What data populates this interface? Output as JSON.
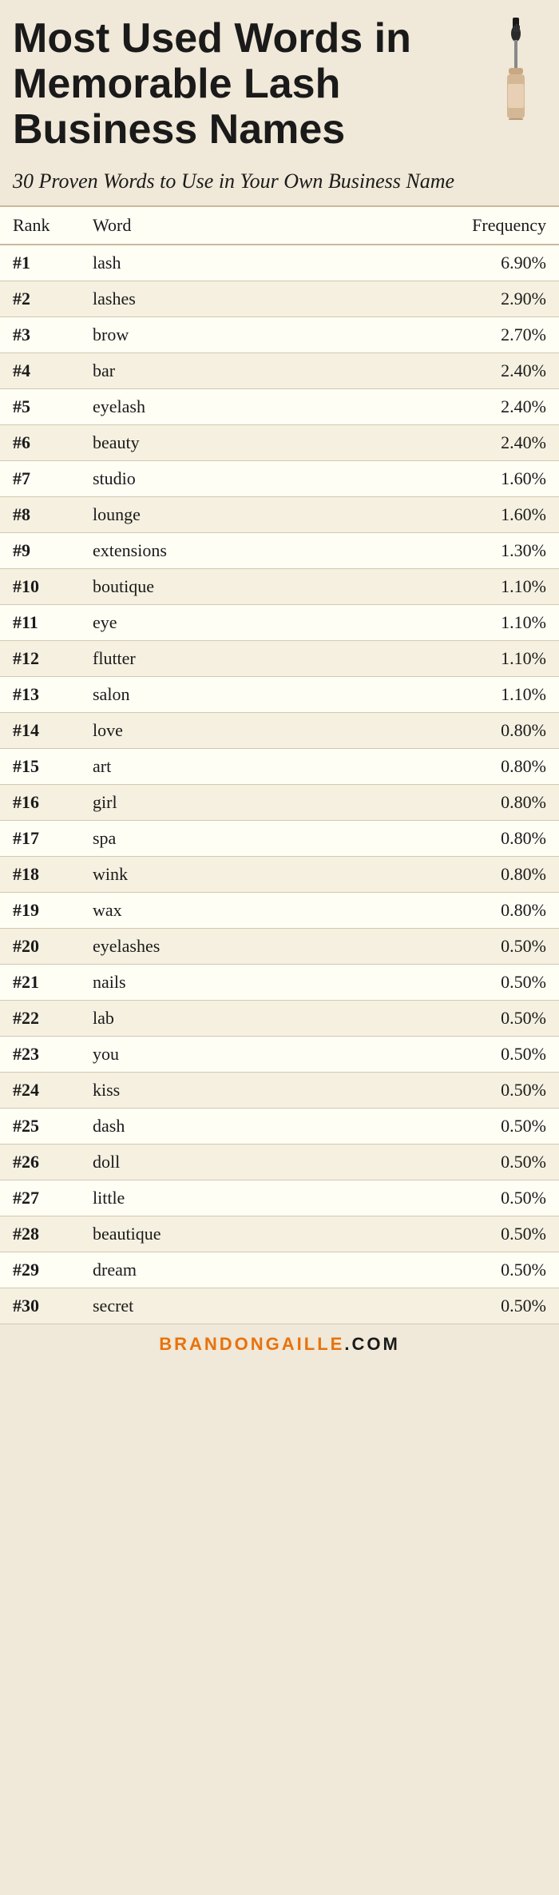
{
  "header": {
    "main_title": "Most Used Words in Memorable Lash Business Names",
    "subtitle": "30 Proven Words to Use in Your Own Business Name"
  },
  "table": {
    "columns": [
      "Rank",
      "Word",
      "Frequency"
    ],
    "rows": [
      {
        "rank": "#1",
        "word": "lash",
        "frequency": "6.90%"
      },
      {
        "rank": "#2",
        "word": "lashes",
        "frequency": "2.90%"
      },
      {
        "rank": "#3",
        "word": "brow",
        "frequency": "2.70%"
      },
      {
        "rank": "#4",
        "word": "bar",
        "frequency": "2.40%"
      },
      {
        "rank": "#5",
        "word": "eyelash",
        "frequency": "2.40%"
      },
      {
        "rank": "#6",
        "word": "beauty",
        "frequency": "2.40%"
      },
      {
        "rank": "#7",
        "word": "studio",
        "frequency": "1.60%"
      },
      {
        "rank": "#8",
        "word": "lounge",
        "frequency": "1.60%"
      },
      {
        "rank": "#9",
        "word": "extensions",
        "frequency": "1.30%"
      },
      {
        "rank": "#10",
        "word": "boutique",
        "frequency": "1.10%"
      },
      {
        "rank": "#11",
        "word": "eye",
        "frequency": "1.10%"
      },
      {
        "rank": "#12",
        "word": "flutter",
        "frequency": "1.10%"
      },
      {
        "rank": "#13",
        "word": "salon",
        "frequency": "1.10%"
      },
      {
        "rank": "#14",
        "word": "love",
        "frequency": "0.80%"
      },
      {
        "rank": "#15",
        "word": "art",
        "frequency": "0.80%"
      },
      {
        "rank": "#16",
        "word": "girl",
        "frequency": "0.80%"
      },
      {
        "rank": "#17",
        "word": "spa",
        "frequency": "0.80%"
      },
      {
        "rank": "#18",
        "word": "wink",
        "frequency": "0.80%"
      },
      {
        "rank": "#19",
        "word": "wax",
        "frequency": "0.80%"
      },
      {
        "rank": "#20",
        "word": "eyelashes",
        "frequency": "0.50%"
      },
      {
        "rank": "#21",
        "word": "nails",
        "frequency": "0.50%"
      },
      {
        "rank": "#22",
        "word": "lab",
        "frequency": "0.50%"
      },
      {
        "rank": "#23",
        "word": "you",
        "frequency": "0.50%"
      },
      {
        "rank": "#24",
        "word": "kiss",
        "frequency": "0.50%"
      },
      {
        "rank": "#25",
        "word": "dash",
        "frequency": "0.50%"
      },
      {
        "rank": "#26",
        "word": "doll",
        "frequency": "0.50%"
      },
      {
        "rank": "#27",
        "word": "little",
        "frequency": "0.50%"
      },
      {
        "rank": "#28",
        "word": "beautique",
        "frequency": "0.50%"
      },
      {
        "rank": "#29",
        "word": "dream",
        "frequency": "0.50%"
      },
      {
        "rank": "#30",
        "word": "secret",
        "frequency": "0.50%"
      }
    ]
  },
  "footer": {
    "text_orange": "BRANDONGAILLE",
    "text_dark": ".COM"
  }
}
